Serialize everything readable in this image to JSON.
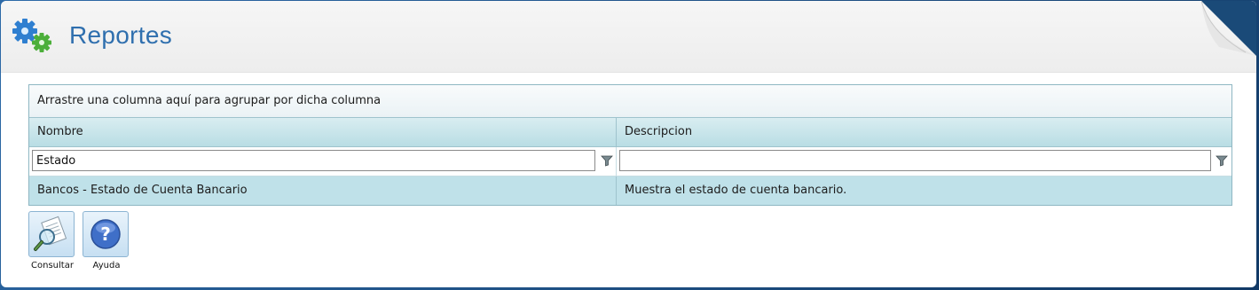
{
  "header": {
    "title": "Reportes",
    "app_icon": "gears-icon"
  },
  "grid": {
    "group_panel_text": "Arrastre una columna aquí para agrupar por dicha columna",
    "columns": [
      {
        "label": "Nombre"
      },
      {
        "label": "Descripcion"
      }
    ],
    "filters": [
      {
        "value": "Estado",
        "icon": "filter-icon"
      },
      {
        "value": "",
        "icon": "filter-icon"
      }
    ],
    "rows": [
      {
        "nombre": "Bancos - Estado de Cuenta Bancario",
        "descripcion": "Muestra el estado de cuenta bancario."
      }
    ]
  },
  "toolbar": {
    "consultar_label": "Consultar",
    "consultar_icon": "document-search-icon",
    "ayuda_label": "Ayuda",
    "ayuda_icon": "help-icon"
  },
  "colors": {
    "title": "#2f6fae",
    "grid_border": "#8fb7c3",
    "header_row": "#b9dde4",
    "selected_row": "#bfe1e9",
    "frame": "#1a4a78"
  }
}
